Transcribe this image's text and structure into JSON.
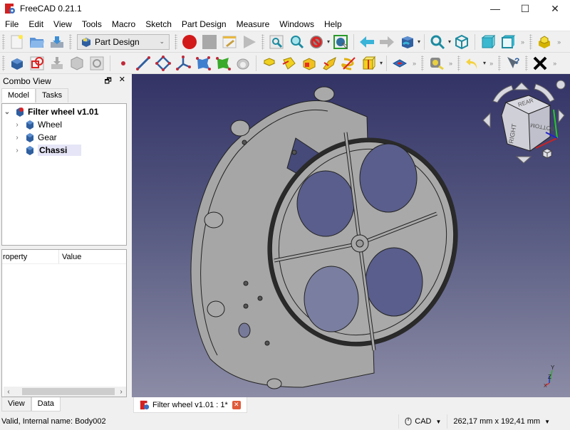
{
  "window": {
    "title": "FreeCAD 0.21.1",
    "minimize_glyph": "—",
    "maximize_glyph": "☐",
    "close_glyph": "✕"
  },
  "menu": [
    "File",
    "Edit",
    "View",
    "Tools",
    "Macro",
    "Sketch",
    "Part Design",
    "Measure",
    "Windows",
    "Help"
  ],
  "toolbar": {
    "workbench_selector": "Part Design",
    "more_glyph": "»",
    "dropdown_glyph": "▾"
  },
  "combo_view": {
    "title": "Combo View",
    "float_glyph": "🗗",
    "close_glyph": "✕",
    "tabs": [
      "Model",
      "Tasks"
    ],
    "tree": {
      "root": "Filter wheel v1.01",
      "children": [
        {
          "label": "Wheel",
          "selected": false
        },
        {
          "label": "Gear",
          "selected": false
        },
        {
          "label": "Chassi",
          "selected": true
        }
      ]
    },
    "property_header": [
      "roperty",
      "Value"
    ],
    "bottom_tabs": [
      "View",
      "Data"
    ]
  },
  "viewport": {
    "navcube_faces": [
      "REAR",
      "RIGHT",
      "BOTTOM"
    ],
    "axis_labels": [
      "Y",
      "Z",
      "X"
    ],
    "colors": {
      "bg_top": "#333366",
      "bg_bottom": "#8c8ca6",
      "part": "#a9a9a9"
    }
  },
  "document_tab": {
    "label": "Filter wheel v1.01 : 1*",
    "close_glyph": "✕"
  },
  "status": {
    "message": "Valid, Internal name: Body002",
    "navigation_style": "CAD",
    "dimensions": "262,17 mm x 192,41 mm"
  }
}
